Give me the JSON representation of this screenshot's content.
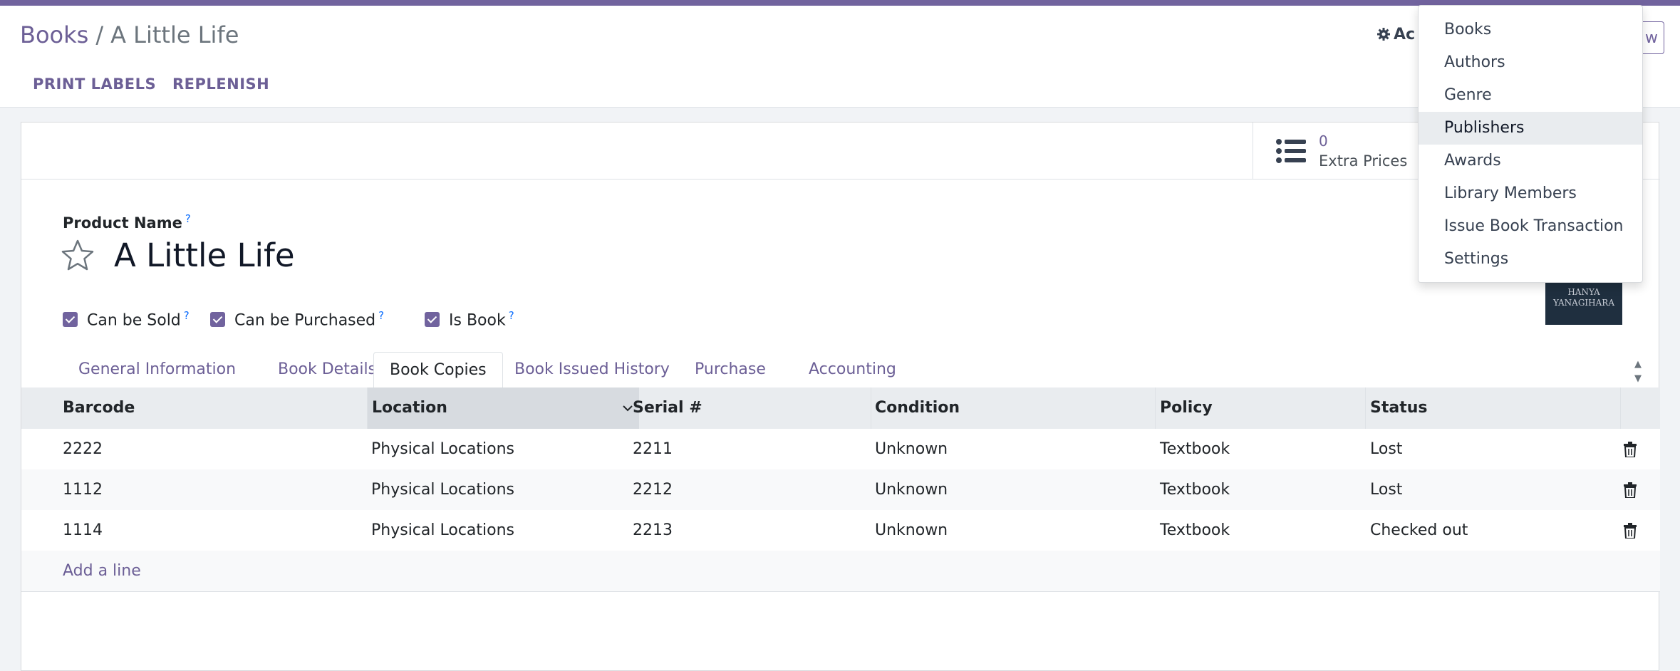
{
  "header": {
    "breadcrumb_parent": "Books",
    "breadcrumb_separator": "/",
    "breadcrumb_current": "A Little Life",
    "action_label": "Ac",
    "edge_button_label": "w"
  },
  "controls": {
    "print_labels": "PRINT LABELS",
    "replenish": "REPLENISH"
  },
  "stat_button": {
    "value": "0",
    "label": "Extra Prices",
    "icon": "list-icon"
  },
  "form": {
    "product_name_label": "Product Name",
    "help_mark": "?",
    "title": "A Little Life",
    "cover_text": "HANYA YANAGIHARA",
    "checkboxes": [
      {
        "label": "Can be Sold",
        "checked": true
      },
      {
        "label": "Can be Purchased",
        "checked": true
      },
      {
        "label": "Is Book",
        "checked": true
      }
    ]
  },
  "tabs": [
    {
      "label": "General Information",
      "active": false
    },
    {
      "label": "Book Details",
      "active": false
    },
    {
      "label": "Book Copies",
      "active": true
    },
    {
      "label": "Book Issued History",
      "active": false
    },
    {
      "label": "Purchase",
      "active": false
    },
    {
      "label": "Accounting",
      "active": false
    }
  ],
  "table": {
    "columns": [
      "Barcode",
      "Location",
      "Serial #",
      "Condition",
      "Policy",
      "Status"
    ],
    "sorted_column": "Location",
    "rows": [
      [
        "2222",
        "Physical Locations",
        "2211",
        "Unknown",
        "Textbook",
        "Lost"
      ],
      [
        "1112",
        "Physical Locations",
        "2212",
        "Unknown",
        "Textbook",
        "Lost"
      ],
      [
        "1114",
        "Physical Locations",
        "2213",
        "Unknown",
        "Textbook",
        "Checked out"
      ]
    ],
    "add_line": "Add a line"
  },
  "dropdown": {
    "items": [
      "Books",
      "Authors",
      "Genre",
      "Publishers",
      "Awards",
      "Library Members",
      "Issue Book Transaction",
      "Settings"
    ],
    "highlighted": "Publishers"
  },
  "colors": {
    "accent": "#71639e",
    "link": "#6c5f96",
    "help": "#0d6efd"
  }
}
